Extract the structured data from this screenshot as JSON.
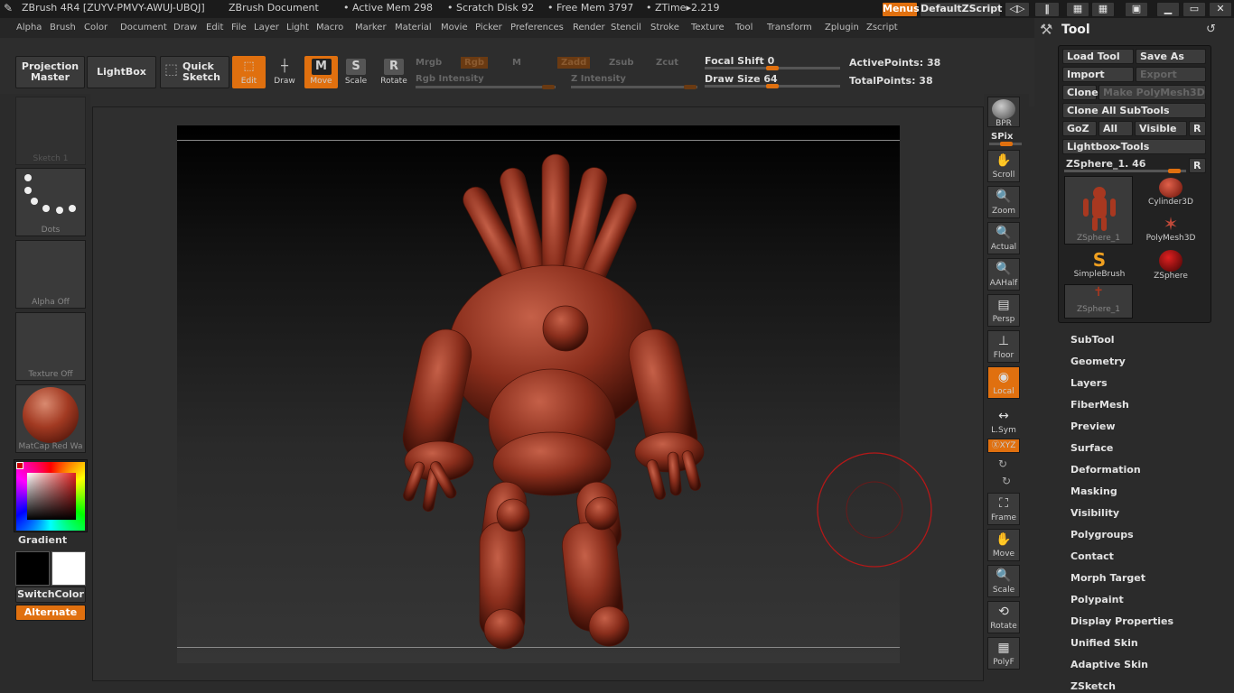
{
  "title": {
    "app": "ZBrush 4R4 [ZUYV-PMVY-AWUJ-UBQJ]",
    "doc": "ZBrush Document",
    "active_mem": "• Active Mem 298",
    "scratch": "• Scratch Disk 92",
    "free_mem": "• Free Mem 3797",
    "ztime": "• ZTime▸2.219",
    "menus": "Menus",
    "zscript": "DefaultZScript"
  },
  "menu": [
    "Alpha",
    "Brush",
    "Color",
    "Document",
    "Draw",
    "Edit",
    "File",
    "Layer",
    "Light",
    "Macro",
    "Marker",
    "Material",
    "Movie",
    "Picker",
    "Preferences",
    "Render",
    "Stencil",
    "Stroke",
    "Texture",
    "Tool",
    "Transform",
    "Zplugin",
    "Zscript"
  ],
  "toolbar": {
    "projection": "Projection",
    "master": "Master",
    "lightbox": "LightBox",
    "quick": "Quick",
    "sketch": "Sketch",
    "edit": "Edit",
    "draw": "Draw",
    "move": "Move",
    "scale": "Scale",
    "rotate": "Rotate",
    "mrgb": "Mrgb",
    "rgb": "Rgb",
    "m": "M",
    "zadd": "Zadd",
    "zsub": "Zsub",
    "zcut": "Zcut",
    "rgb_int": "Rgb Intensity",
    "z_int": "Z Intensity",
    "focal": "Focal Shift",
    "focal_val": "0",
    "drawsize": "Draw Size",
    "drawsize_val": "64",
    "active_pts": "ActivePoints: 38",
    "total_pts": "TotalPoints: 38"
  },
  "left": {
    "sketch": "Sketch 1",
    "dots": "Dots",
    "alpha": "Alpha Off",
    "texture": "Texture Off",
    "matcap": "MatCap Red Wa",
    "gradient": "Gradient",
    "switch": "SwitchColor",
    "alternate": "Alternate"
  },
  "right": {
    "bpr": "BPR",
    "spix": "SPix",
    "scroll": "Scroll",
    "zoom": "Zoom",
    "actual": "Actual",
    "aahalf": "AAHalf",
    "persp": "Persp",
    "floor": "Floor",
    "local": "Local",
    "lsym": "L.Sym",
    "xyz": "ⓍXYZ",
    "frame": "Frame",
    "move": "Move",
    "scale": "Scale",
    "rotate": "Rotate",
    "polyf": "PolyF"
  },
  "panel": {
    "title": "Tool",
    "load": "Load Tool",
    "save": "Save As",
    "import": "Import",
    "export": "Export",
    "clone": "Clone",
    "make": "Make PolyMesh3D",
    "cloneall": "Clone All SubTools",
    "goz": "GoZ",
    "all": "All",
    "visible": "Visible",
    "r": "R",
    "lightbox": "Lightbox▸Tools",
    "zsphere": "ZSphere_1. 46",
    "tools": [
      "ZSphere_1",
      "Cylinder3D",
      "PolyMesh3D",
      "SimpleBrush",
      "ZSphere",
      "ZSphere_1"
    ],
    "sections": [
      "SubTool",
      "Geometry",
      "Layers",
      "FiberMesh",
      "Preview",
      "Surface",
      "Deformation",
      "Masking",
      "Visibility",
      "Polygroups",
      "Contact",
      "Morph Target",
      "Polypaint",
      "Display Properties",
      "Unified Skin",
      "Adaptive Skin",
      "ZSketch"
    ]
  },
  "colors": {
    "accent": "#e0700f",
    "model": "#8a3020"
  }
}
